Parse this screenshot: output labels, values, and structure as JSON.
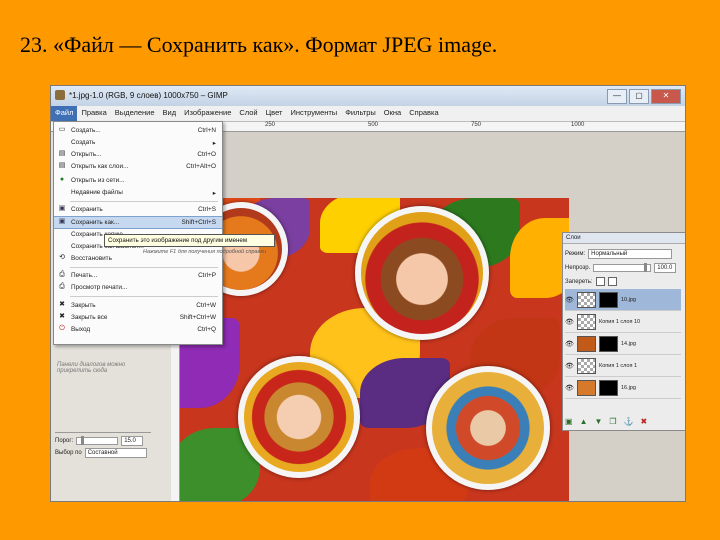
{
  "slide": {
    "title": "23. «Файл — Сохранить как». Формат JPEG image."
  },
  "window": {
    "title": "*1.jpg-1.0 (RGB, 9 слоев) 1000x750 – GIMP",
    "buttons": [
      "—",
      "▢",
      "✕"
    ]
  },
  "menubar": [
    "Файл",
    "Правка",
    "Выделение",
    "Вид",
    "Изображение",
    "Слой",
    "Цвет",
    "Инструменты",
    "Фильтры",
    "Окна",
    "Справка"
  ],
  "ruler": [
    "250",
    "500",
    "750",
    "1000"
  ],
  "file_menu": [
    {
      "label": "Создать...",
      "shortcut": "Ctrl+N",
      "icon": "new-icon"
    },
    {
      "label": "Создать",
      "shortcut": "▸",
      "icon": ""
    },
    {
      "label": "Открыть...",
      "shortcut": "Ctrl+O",
      "icon": "open-icon"
    },
    {
      "label": "Открыть как слои...",
      "shortcut": "Ctrl+Alt+O",
      "icon": "open-layers-icon"
    },
    {
      "label": "Открыть из сети...",
      "shortcut": "",
      "icon": "globe-icon"
    },
    {
      "label": "Недавние файлы",
      "shortcut": "▸",
      "icon": ""
    },
    {
      "label": "Сохранить",
      "shortcut": "Ctrl+S",
      "icon": "save-icon"
    },
    {
      "label": "Сохранить как...",
      "shortcut": "Shift+Ctrl+S",
      "icon": "save-as-icon"
    },
    {
      "label": "Сохранить копию...",
      "shortcut": "",
      "icon": ""
    },
    {
      "label": "Сохранить как шаблон...",
      "shortcut": "",
      "icon": ""
    },
    {
      "label": "Восстановить",
      "shortcut": "",
      "icon": "revert-icon"
    },
    {
      "label": "Печать...",
      "shortcut": "Ctrl+P",
      "icon": "print-icon"
    },
    {
      "label": "Просмотр печати...",
      "shortcut": "",
      "icon": "print-preview-icon"
    },
    {
      "label": "Закрыть",
      "shortcut": "Ctrl+W",
      "icon": "close-icon"
    },
    {
      "label": "Закрыть все",
      "shortcut": "Shift+Ctrl+W",
      "icon": "close-all-icon"
    },
    {
      "label": "Выход",
      "shortcut": "Ctrl+Q",
      "icon": "quit-icon"
    }
  ],
  "tooltip": {
    "text": "Сохранить это изображение под другим именем",
    "hint": "Нажмите F1 для получения подробной справки"
  },
  "left_dock": {
    "hint": "Панели диалогов можно прикрепить сюда",
    "threshold_label": "Порог:",
    "threshold_value": "15.0",
    "select_by_label": "Выбор по",
    "select_by_value": "Составной"
  },
  "layers_panel": {
    "title": "Слои",
    "mode_label": "Режим:",
    "mode_value": "Нормальный",
    "opacity_label": "Непрозр.",
    "opacity_value": "100.0",
    "lock_label": "Запереть:",
    "layers": [
      {
        "name": "10.jpg",
        "selected": true
      },
      {
        "name": "Копия 1 слоя 10",
        "selected": false
      },
      {
        "name": "14.jpg",
        "selected": false
      },
      {
        "name": "Копия 1 слоя 1",
        "selected": false
      },
      {
        "name": "16.jpg",
        "selected": false
      }
    ],
    "bottom_buttons": [
      "▣",
      "▲",
      "▼",
      "❐",
      "⚓",
      "✖"
    ]
  },
  "colors": {
    "slide_bg": "#ff9900",
    "menu_highlight": "#3f6fb5",
    "selected_item": "#c6d8f0"
  }
}
